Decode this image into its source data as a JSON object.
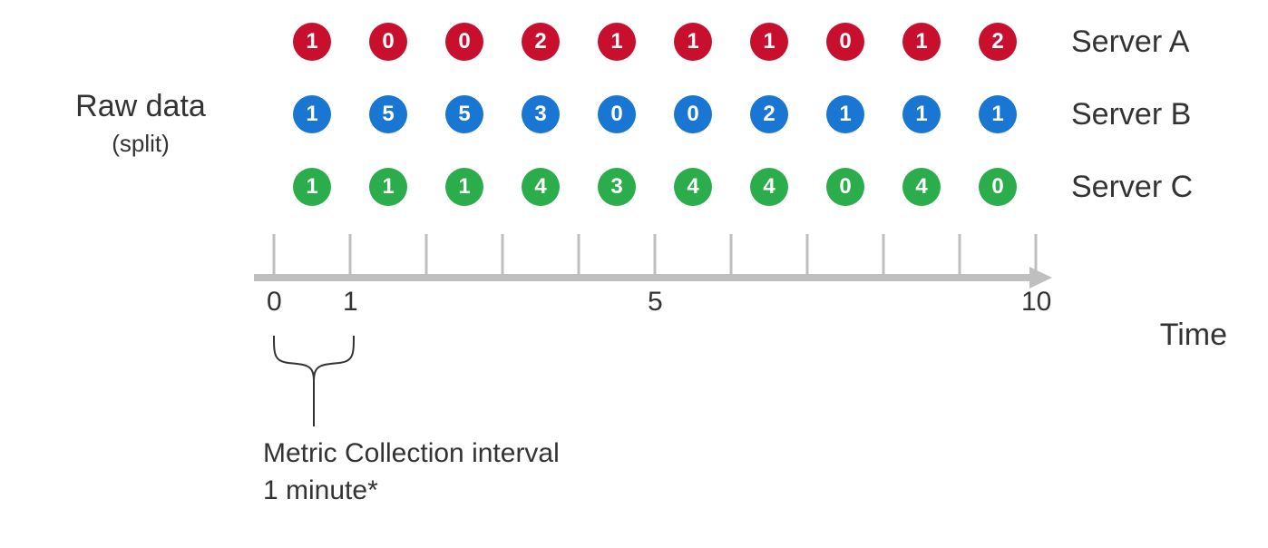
{
  "left_label": {
    "title": "Raw data",
    "subtitle": "(split)"
  },
  "chart_data": {
    "type": "table",
    "title": "Raw data (split)",
    "xlabel": "Time",
    "tick_values": [
      "0",
      "1",
      "5",
      "10"
    ],
    "series": [
      {
        "name": "Server A",
        "color": "#c8102e",
        "values": [
          1,
          0,
          0,
          2,
          1,
          1,
          1,
          0,
          1,
          2
        ]
      },
      {
        "name": "Server B",
        "color": "#1976d2",
        "values": [
          1,
          5,
          5,
          3,
          0,
          0,
          2,
          1,
          1,
          1
        ]
      },
      {
        "name": "Server C",
        "color": "#2aad4a",
        "values": [
          1,
          1,
          1,
          4,
          3,
          4,
          4,
          0,
          4,
          0
        ]
      }
    ],
    "interval_note": {
      "line1": "Metric Collection interval",
      "line2": "1 minute*"
    }
  },
  "colors": {
    "red": "#c8102e",
    "blue": "#1976d2",
    "green": "#2aad4a",
    "axis": "#bfbfbf"
  }
}
